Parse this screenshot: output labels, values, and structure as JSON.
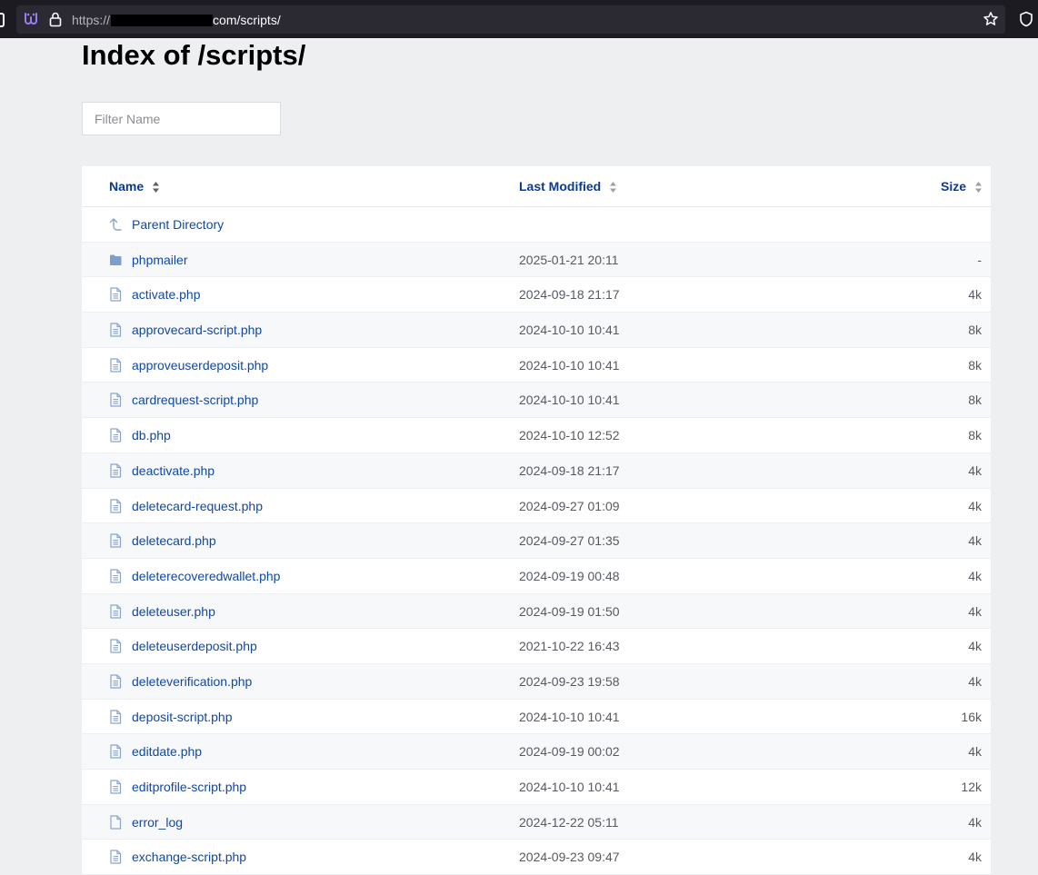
{
  "browser": {
    "url_prefix": "https://",
    "url_suffix": "com/scripts/"
  },
  "page": {
    "title": "Index of /scripts/",
    "filter_placeholder": "Filter Name"
  },
  "table": {
    "headers": {
      "name": "Name",
      "modified": "Last Modified",
      "size": "Size"
    },
    "parent": {
      "name": "Parent Directory",
      "icon": "up-arrow-icon"
    },
    "rows": [
      {
        "name": "phpmailer",
        "modified": "2025-01-21 20:11",
        "size": "-",
        "icon": "folder-icon"
      },
      {
        "name": "activate.php",
        "modified": "2024-09-18 21:17",
        "size": "4k",
        "icon": "file-text-icon"
      },
      {
        "name": "approvecard-script.php",
        "modified": "2024-10-10 10:41",
        "size": "8k",
        "icon": "file-text-icon"
      },
      {
        "name": "approveuserdeposit.php",
        "modified": "2024-10-10 10:41",
        "size": "8k",
        "icon": "file-text-icon"
      },
      {
        "name": "cardrequest-script.php",
        "modified": "2024-10-10 10:41",
        "size": "8k",
        "icon": "file-text-icon"
      },
      {
        "name": "db.php",
        "modified": "2024-10-10 12:52",
        "size": "8k",
        "icon": "file-text-icon"
      },
      {
        "name": "deactivate.php",
        "modified": "2024-09-18 21:17",
        "size": "4k",
        "icon": "file-text-icon"
      },
      {
        "name": "deletecard-request.php",
        "modified": "2024-09-27 01:09",
        "size": "4k",
        "icon": "file-text-icon"
      },
      {
        "name": "deletecard.php",
        "modified": "2024-09-27 01:35",
        "size": "4k",
        "icon": "file-text-icon"
      },
      {
        "name": "deleterecoveredwallet.php",
        "modified": "2024-09-19 00:48",
        "size": "4k",
        "icon": "file-text-icon"
      },
      {
        "name": "deleteuser.php",
        "modified": "2024-09-19 01:50",
        "size": "4k",
        "icon": "file-text-icon"
      },
      {
        "name": "deleteuserdeposit.php",
        "modified": "2021-10-22 16:43",
        "size": "4k",
        "icon": "file-text-icon"
      },
      {
        "name": "deleteverification.php",
        "modified": "2024-09-23 19:58",
        "size": "4k",
        "icon": "file-text-icon"
      },
      {
        "name": "deposit-script.php",
        "modified": "2024-10-10 10:41",
        "size": "16k",
        "icon": "file-text-icon"
      },
      {
        "name": "editdate.php",
        "modified": "2024-09-19 00:02",
        "size": "4k",
        "icon": "file-text-icon"
      },
      {
        "name": "editprofile-script.php",
        "modified": "2024-10-10 10:41",
        "size": "12k",
        "icon": "file-text-icon"
      },
      {
        "name": "error_log",
        "modified": "2024-12-22 05:11",
        "size": "4k",
        "icon": "file-icon"
      },
      {
        "name": "exchange-script.php",
        "modified": "2024-09-23 09:47",
        "size": "4k",
        "icon": "file-text-icon"
      }
    ]
  }
}
